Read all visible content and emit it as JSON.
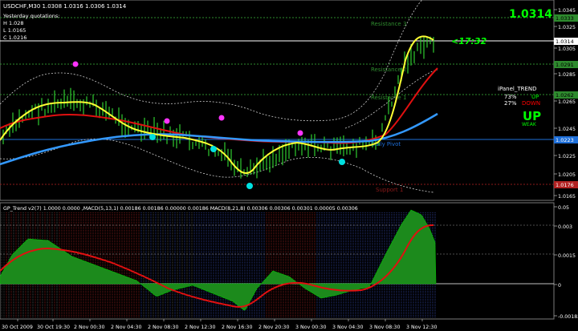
{
  "main": {
    "title": "USDCHF,M30  1.0308 1.0316 1.0306 1.0314",
    "yesterday": {
      "header": "Yesterday quotations:",
      "high": "H 1.028",
      "low": "L 1.0165",
      "close": "C 1.0216"
    },
    "price_big": "1.0314",
    "countdown": "<17:32",
    "resistance_labels": [
      "Resistance 3",
      "Resistance 2",
      "Resistance 1"
    ],
    "pivot_label": "Daily Pivot",
    "support_label": "Support 1",
    "y_ticks": [
      "1.0345",
      "1.0325",
      "1.0305",
      "1.0285",
      "1.0265",
      "1.0245",
      "1.0225",
      "1.0205",
      "1.0185",
      "1.0165"
    ],
    "price_tags": [
      {
        "text": "1.0333",
        "color": "#2e8b2e"
      },
      {
        "text": "1.0314",
        "color": "#ffffff"
      },
      {
        "text": "1.0291",
        "color": "#2e8b2e"
      },
      {
        "text": "1.0262",
        "color": "#2e8b2e"
      },
      {
        "text": "1.0223",
        "color": "#1e6fd9"
      },
      {
        "text": "1.0176",
        "color": "#b22222"
      }
    ],
    "ipanel": {
      "title": "iPanel_TREND",
      "row1_pct": "73%",
      "row1_label": "UP",
      "row2_pct": "27%",
      "row2_label": "DOWN",
      "trend": "UP",
      "strength": "WEAK"
    }
  },
  "sub": {
    "title": "GP_Trend v2(7) 1.0000 0.0000 ,MACD(5,13,1) 0.00186 0.00186 0.00000 0.00186  MACD(8,21,8) 0.00306 0.00306 0.00301 0.00005 0.00306",
    "y_ticks": [
      "0.05",
      "0.003",
      "0.0015",
      "0",
      "-0.00183"
    ]
  },
  "time_axis": [
    "30 Oct 2009",
    "30 Oct 19:30",
    "2 Nov 00:30",
    "2 Nov 04:30",
    "2 Nov 08:30",
    "2 Nov 12:30",
    "2 Nov 16:30",
    "2 Nov 20:30",
    "3 Nov 00:30",
    "3 Nov 04:30",
    "3 Nov 08:30",
    "3 Nov 12:30"
  ],
  "colors": {
    "background": "#000000",
    "bars": "#2ecc2e",
    "fast_ma": "#ffff33",
    "mid_ma": "#e01010",
    "slow_ma": "#3399ff",
    "pivot_dot": "#00e0e0",
    "signal_dot": "#ff33ff",
    "up_green": "#00ff00",
    "down_red": "#ff0000"
  }
}
